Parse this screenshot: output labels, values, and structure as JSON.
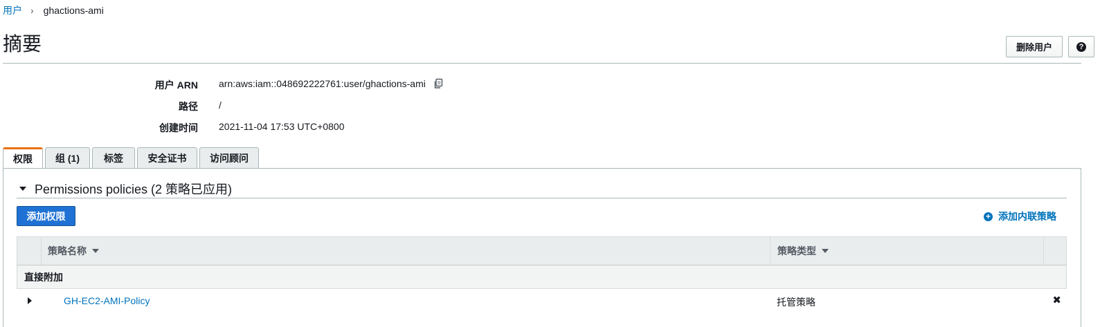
{
  "breadcrumb": {
    "parent": "用户",
    "separator": "›",
    "current": "ghactions-ami"
  },
  "page": {
    "title": "摘要",
    "delete_user_label": "删除用户",
    "help_icon": "question-circle-icon",
    "help_glyph": "?"
  },
  "summary": {
    "arn_label": "用户 ARN",
    "arn_value": "arn:aws:iam::048692222761:user/ghactions-ami",
    "path_label": "路径",
    "path_value": "/",
    "created_label": "创建时间",
    "created_value": "2021-11-04 17:53 UTC+0800"
  },
  "tabs": [
    {
      "label": "权限",
      "active": true
    },
    {
      "label": "组 (1)",
      "active": false
    },
    {
      "label": "标签",
      "active": false
    },
    {
      "label": "安全证书",
      "active": false
    },
    {
      "label": "访问顾问",
      "active": false
    }
  ],
  "permissions": {
    "section_title": "Permissions policies (2 策略已应用)",
    "add_permission_label": "添加权限",
    "add_inline_label": "添加内联策略",
    "add_inline_glyph": "+",
    "table": {
      "col_name": "策略名称",
      "col_type": "策略类型",
      "group_label": "直接附加",
      "rows": [
        {
          "name": "GH-EC2-AMI-Policy",
          "type": "托管策略",
          "remove_glyph": "✖"
        }
      ]
    }
  },
  "colors": {
    "link": "#0073bb",
    "primary_button": "#1f72d4",
    "active_tab_accent": "#ec7211"
  }
}
